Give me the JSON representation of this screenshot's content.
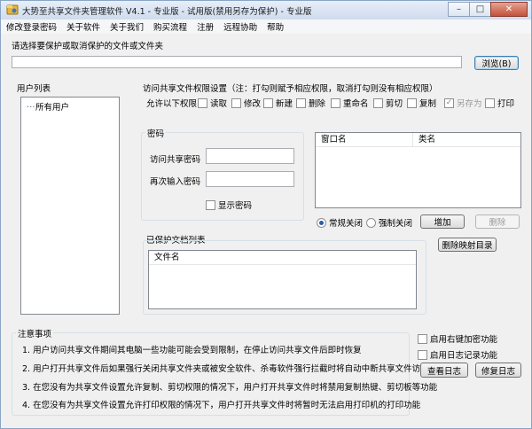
{
  "window": {
    "title": "大势至共享文件夹管理软件 V4.1 - 专业版 - 试用版(禁用另存为保护) - 专业版",
    "minimize": "–",
    "maximize": "□",
    "close": "✕"
  },
  "menu": [
    "修改登录密码",
    "关于软件",
    "关于我们",
    "购买流程",
    "注册",
    "远程协助",
    "帮助"
  ],
  "path_section": {
    "label": "请选择要保护或取消保护的文件或文件夹",
    "path_value": "",
    "browse_button": "浏览(B)"
  },
  "user_list": {
    "title": "用户列表",
    "items": [
      "所有用户"
    ]
  },
  "permissions": {
    "title": "访问共享文件权限设置（注：打勾则赋予相应权限，取消打勾则没有相应权限）",
    "allow_label": "允许以下权限",
    "items": [
      {
        "label": "读取",
        "checked": false,
        "disabled": false
      },
      {
        "label": "修改",
        "checked": false,
        "disabled": false
      },
      {
        "label": "新建",
        "checked": false,
        "disabled": false
      },
      {
        "label": "删除",
        "checked": false,
        "disabled": false
      },
      {
        "label": "重命名",
        "checked": false,
        "disabled": false
      },
      {
        "label": "剪切",
        "checked": false,
        "disabled": false
      },
      {
        "label": "复制",
        "checked": false,
        "disabled": false
      },
      {
        "label": "另存为",
        "checked": true,
        "disabled": true
      },
      {
        "label": "打印",
        "checked": false,
        "disabled": false
      }
    ]
  },
  "password": {
    "title": "密码",
    "access_label": "访问共享密码",
    "access_value": "",
    "confirm_label": "再次输入密码",
    "confirm_value": "",
    "show_label": "显示密码"
  },
  "window_list": {
    "col_window": "窗口名",
    "col_class": "类名"
  },
  "close_mode": {
    "normal": "常规关闭",
    "force": "强制关闭",
    "selected": "normal",
    "add_button": "增加",
    "delete_button": "删除",
    "delete_mapping_button": "删除映射目录"
  },
  "protected_docs": {
    "title": "已保护文档列表",
    "col_file": "文件名"
  },
  "notes": {
    "title": "注意事项",
    "lines": [
      "1. 用户访问共享文件期间其电脑一些功能可能会受到限制，在停止访问共享文件后即时恢复",
      "2. 用户打开共享文件后如果强行关闭共享文件夹或被安全软件、杀毒软件强行拦截时将自动中断共享文件访问",
      "3. 在您没有为共享文件设置允许复制、剪切权限的情况下，用户打开共享文件时将禁用复制热键、剪切板等功能",
      "4. 在您没有为共享文件设置允许打印权限的情况下，用户打开共享文件时将暂时无法启用打印机的打印功能"
    ]
  },
  "side_options": {
    "encrypt_label": "启用右键加密功能",
    "log_label": "启用日志记录功能",
    "view_log_button": "查看日志",
    "repair_log_button": "修复日志"
  }
}
